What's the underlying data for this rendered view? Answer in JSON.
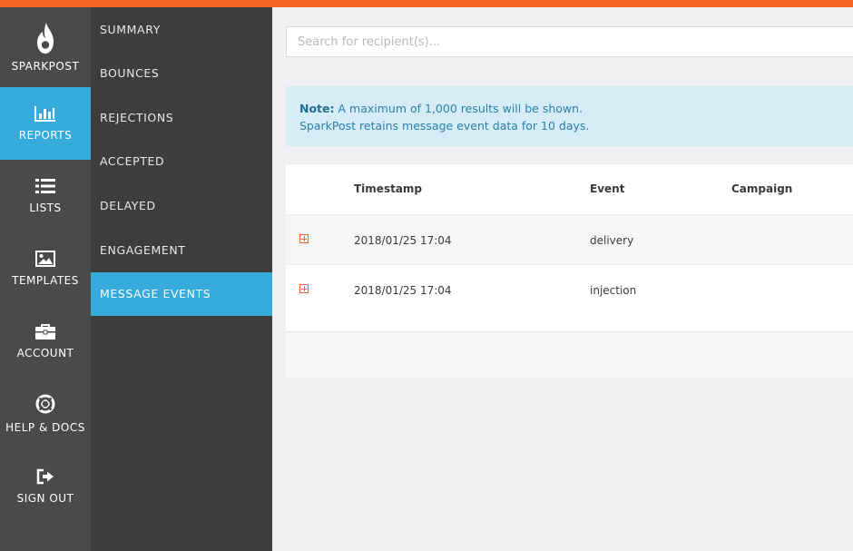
{
  "brand": {
    "name": "SPARKPOST",
    "accent": "#fa6423",
    "active_color": "#37aadc"
  },
  "rail": {
    "items": [
      {
        "label": "REPORTS",
        "icon": "bar-chart-icon",
        "active": true
      },
      {
        "label": "LISTS",
        "icon": "list-icon",
        "active": false
      },
      {
        "label": "TEMPLATES",
        "icon": "image-icon",
        "active": false
      },
      {
        "label": "ACCOUNT",
        "icon": "briefcase-icon",
        "active": false
      },
      {
        "label": "HELP & DOCS",
        "icon": "life-ring-icon",
        "active": false
      },
      {
        "label": "SIGN OUT",
        "icon": "sign-out-icon",
        "active": false
      }
    ]
  },
  "subnav": {
    "items": [
      {
        "label": "SUMMARY",
        "active": false
      },
      {
        "label": "BOUNCES",
        "active": false
      },
      {
        "label": "REJECTIONS",
        "active": false
      },
      {
        "label": "ACCEPTED",
        "active": false
      },
      {
        "label": "DELAYED",
        "active": false
      },
      {
        "label": "ENGAGEMENT",
        "active": false
      },
      {
        "label": "MESSAGE EVENTS",
        "active": true
      }
    ]
  },
  "search": {
    "placeholder": "Search for recipient(s)...",
    "value": ""
  },
  "note": {
    "label": "Note:",
    "line1": "A maximum of 1,000 results will be shown.",
    "line2": "SparkPost retains message event data for 10 days."
  },
  "table": {
    "headers": {
      "timestamp": "Timestamp",
      "event": "Event",
      "campaign": "Campaign"
    },
    "rows": [
      {
        "timestamp": "2018/01/25 17:04",
        "event": "delivery",
        "campaign": ""
      },
      {
        "timestamp": "2018/01/25 17:04",
        "event": "injection",
        "campaign": ""
      }
    ]
  }
}
